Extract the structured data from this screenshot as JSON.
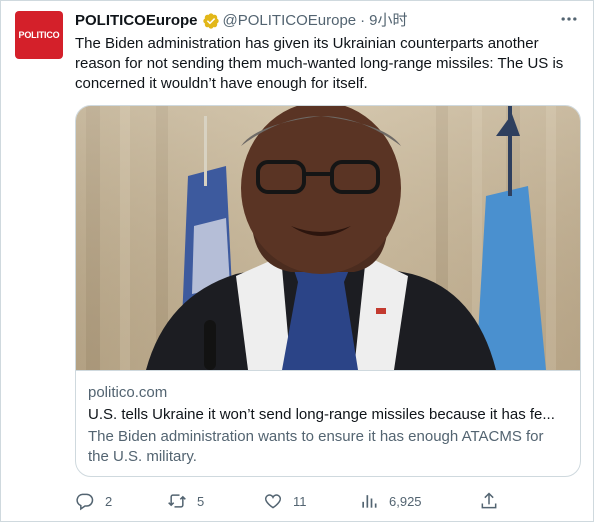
{
  "avatar": {
    "text": "POLITICO"
  },
  "author": {
    "name": "POLITICOEurope",
    "handle": "@POLITICOEurope",
    "separator": "·",
    "time": "9小时"
  },
  "tweet": {
    "text": "The Biden administration has given its Ukrainian counterparts another reason for not sending them much-wanted long-range missiles: The US is concerned it wouldn’t have enough for itself."
  },
  "card": {
    "domain": "politico.com",
    "title": "U.S. tells Ukraine it won’t send long-range missiles because it has fe...",
    "description": "The Biden administration wants to ensure it has enough ATACMS for the U.S. military."
  },
  "actions": {
    "reply_count": "2",
    "retweet_count": "5",
    "like_count": "11",
    "view_count": "6,925"
  },
  "colors": {
    "brand": "#d4202a",
    "verified_gold": "#e2b719",
    "secondary_text": "#536471"
  },
  "icons": [
    "verified-badge-icon",
    "more-icon",
    "reply-icon",
    "retweet-icon",
    "like-icon",
    "views-icon",
    "share-icon"
  ]
}
